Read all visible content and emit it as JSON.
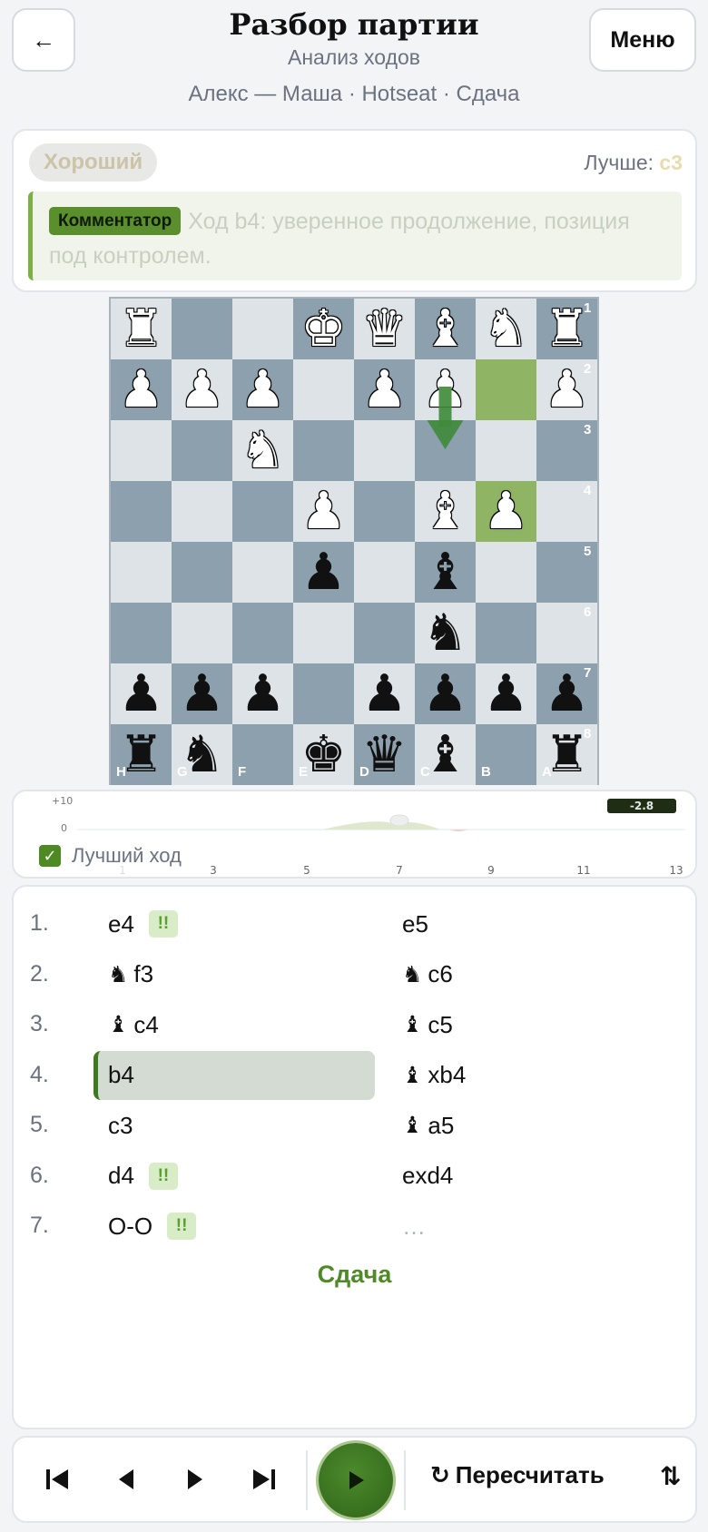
{
  "header": {
    "back_icon": "←",
    "title": "Разбор партии",
    "subtitle": "Анализ ходов",
    "players": "Алекс — Маша · Hotseat · Сдача",
    "menu_label": "Меню"
  },
  "evaluation": {
    "quality": "Хороший",
    "better_label": "Лучше:",
    "better_move": "c3",
    "commentator_tag": "Комментатор",
    "comment": "Ход b4: уверенное продолжение, позиция под контролем."
  },
  "board": {
    "rank_labels": [
      "1",
      "2",
      "3",
      "4",
      "5",
      "6",
      "7",
      "8"
    ],
    "file_labels": [
      "H",
      "G",
      "F",
      "E",
      "D",
      "C",
      "B",
      "A"
    ],
    "highlight_squares": [
      "g2",
      "g4"
    ],
    "arrow": {
      "from": "f2",
      "to": "f3",
      "color": "#3e8a3a"
    }
  },
  "graph": {
    "y_labels": [
      "+10",
      "0"
    ],
    "x_labels": [
      "1",
      "3",
      "5",
      "7",
      "9",
      "11",
      "13"
    ],
    "eval_badge": "-2.8",
    "best_move_label": "Лучший ход",
    "best_move_checked": true
  },
  "moves": [
    {
      "num": "1.",
      "white": "e4",
      "white_piece": "",
      "white_mark": "!!",
      "black": "e5",
      "black_piece": ""
    },
    {
      "num": "2.",
      "white": "f3",
      "white_piece": "♞",
      "white_mark": "",
      "black": "c6",
      "black_piece": "♞"
    },
    {
      "num": "3.",
      "white": "c4",
      "white_piece": "♝",
      "white_mark": "",
      "black": "c5",
      "black_piece": "♝"
    },
    {
      "num": "4.",
      "white": "b4",
      "white_piece": "",
      "white_mark": "",
      "black": "xb4",
      "black_piece": "♝",
      "active": true
    },
    {
      "num": "5.",
      "white": "c3",
      "white_piece": "",
      "white_mark": "",
      "black": "a5",
      "black_piece": "♝"
    },
    {
      "num": "6.",
      "white": "d4",
      "white_piece": "",
      "white_mark": "!!",
      "black": "exd4",
      "black_piece": ""
    },
    {
      "num": "7.",
      "white": "O-O",
      "white_piece": "",
      "white_mark": "!!",
      "black": "…",
      "black_piece": ""
    }
  ],
  "result": "Сдача",
  "controls": {
    "recalc_icon": "↻",
    "recalc_label": "Пересчитать",
    "swap_icon": "⇅"
  },
  "colors": {
    "accent": "#4e8a26",
    "light_square": "#dde3e7",
    "dark_square": "#8ca0ae",
    "highlight": "#8fb463"
  }
}
